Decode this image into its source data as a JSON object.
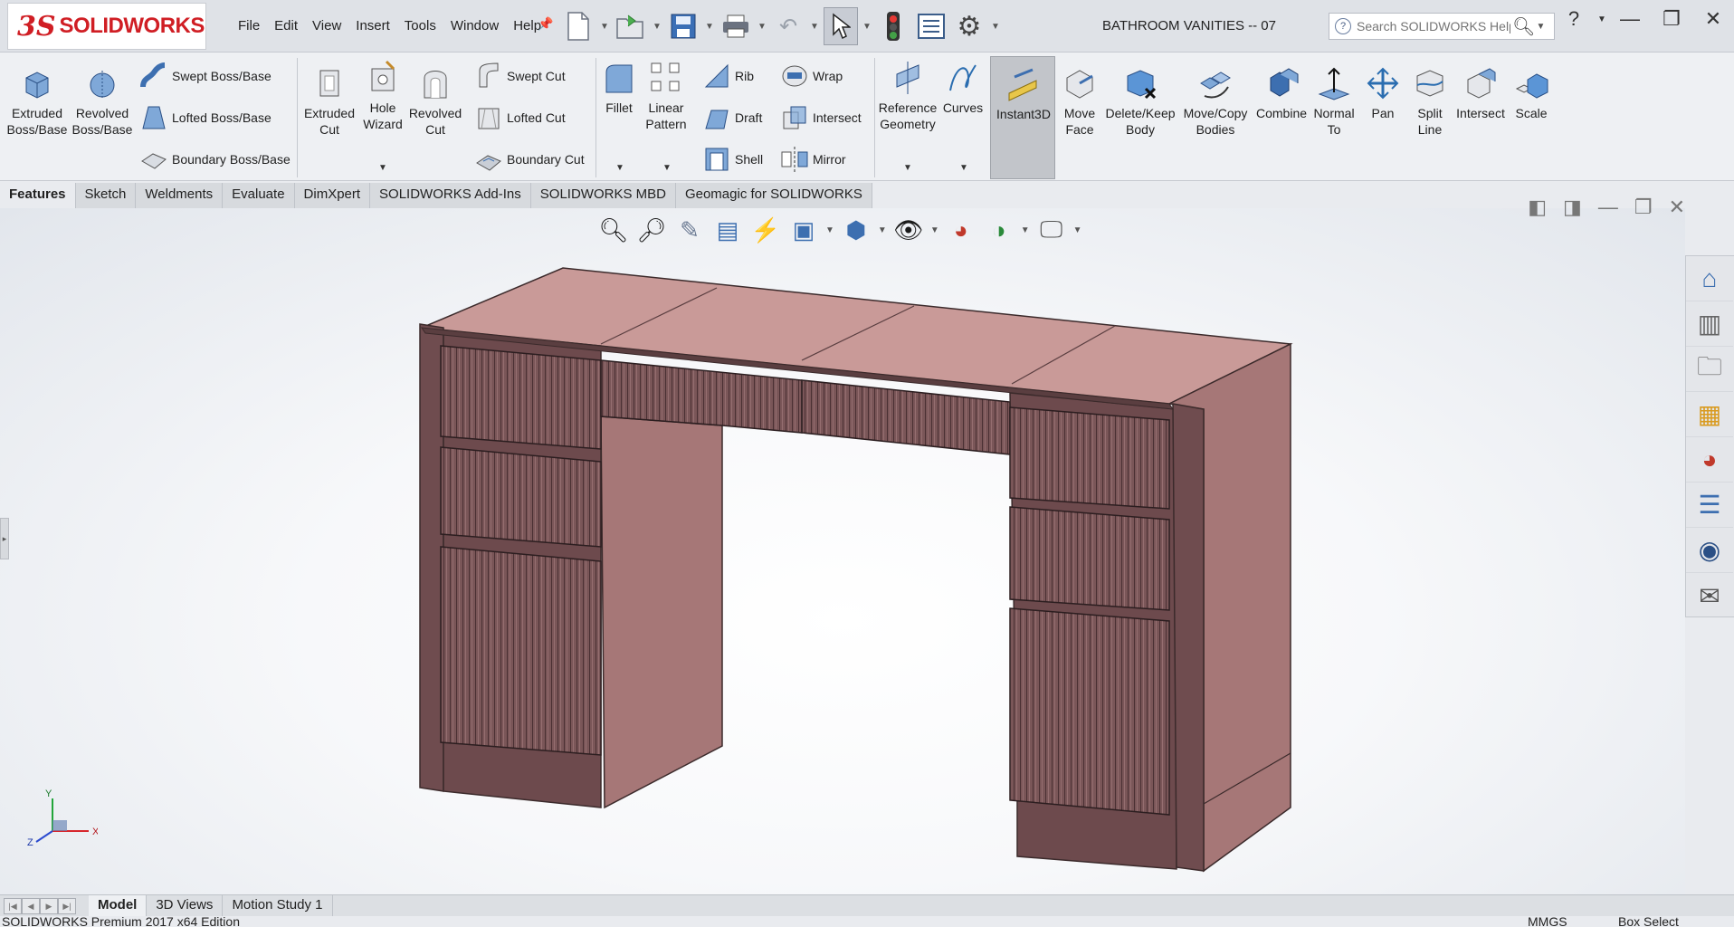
{
  "app": {
    "brand_mark": "3S",
    "brand_name": "SOLIDWORKS"
  },
  "menu": [
    "File",
    "Edit",
    "View",
    "Insert",
    "Tools",
    "Window",
    "Help"
  ],
  "document": {
    "title": "BATHROOM VANITIES -- 07"
  },
  "search": {
    "placeholder": "Search SOLIDWORKS Help"
  },
  "ribbon": {
    "extruded_boss": "Extruded Boss/Base",
    "revolved_boss": "Revolved Boss/Base",
    "swept_boss": "Swept Boss/Base",
    "lofted_boss": "Lofted Boss/Base",
    "boundary_boss": "Boundary Boss/Base",
    "extruded_cut": "Extruded Cut",
    "hole_wizard": "Hole Wizard",
    "revolved_cut": "Revolved Cut",
    "swept_cut": "Swept Cut",
    "lofted_cut": "Lofted Cut",
    "boundary_cut": "Boundary Cut",
    "fillet": "Fillet",
    "linear_pattern": "Linear Pattern",
    "rib": "Rib",
    "draft": "Draft",
    "shell": "Shell",
    "wrap": "Wrap",
    "intersect": "Intersect",
    "mirror": "Mirror",
    "reference_geometry": "Reference Geometry",
    "curves": "Curves",
    "instant3d": "Instant3D",
    "move_face": "Move Face",
    "delete_keep_body": "Delete/Keep Body",
    "move_copy_bodies": "Move/Copy Bodies",
    "combine": "Combine",
    "normal_to": "Normal To",
    "pan": "Pan",
    "split_line": "Split Line",
    "intersect2": "Intersect",
    "scale": "Scale"
  },
  "tabs": [
    "Features",
    "Sketch",
    "Weldments",
    "Evaluate",
    "DimXpert",
    "SOLIDWORKS Add-Ins",
    "SOLIDWORKS MBD",
    "Geomagic for SOLIDWORKS"
  ],
  "triad": {
    "y": "Y",
    "x": "X",
    "z": "Z"
  },
  "bottom_tabs": [
    "Model",
    "3D Views",
    "Motion Study 1"
  ],
  "status": {
    "edition": "SOLIDWORKS Premium 2017 x64 Edition",
    "units": "MMGS",
    "mode": "Box Select"
  },
  "colors": {
    "model_top": "#c99a98",
    "model_front": "#7e5a5c",
    "model_side": "#a67777",
    "accent": "#d01e24"
  }
}
